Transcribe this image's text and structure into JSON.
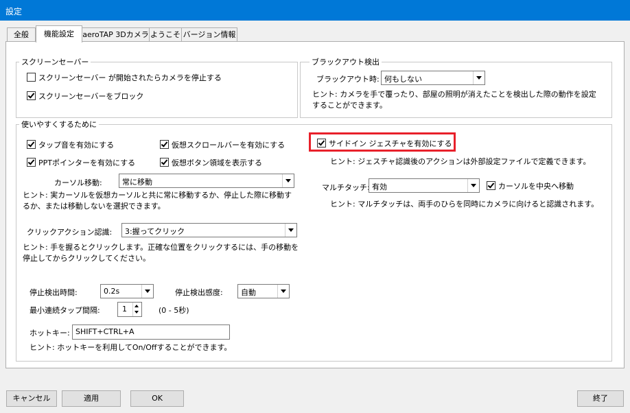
{
  "window": {
    "title": "設定"
  },
  "tabs": [
    {
      "label": "全般",
      "active": false
    },
    {
      "label": "機能設定",
      "active": true
    },
    {
      "label": "aeroTAP 3Dカメラ",
      "active": false
    },
    {
      "label": "ようこそ",
      "active": false
    },
    {
      "label": "バージョン情報",
      "active": false
    }
  ],
  "screensaver": {
    "title": "スクリーンセーバー",
    "stop_camera": {
      "label": "スクリーンセーバー が開始されたらカメラを停止する",
      "checked": false
    },
    "block": {
      "label": "スクリーンセーバーをブロック",
      "checked": true
    }
  },
  "blackout": {
    "title": "ブラックアウト検出",
    "label": "ブラックアウト時:",
    "value": "何もしない",
    "hint": "ヒント: カメラを手で覆ったり、部屋の照明が消えたことを検出した際の動作を設定することができます。"
  },
  "usability": {
    "title": "使いやすくするために",
    "tap_sound": {
      "label": "タップ音を有効にする",
      "checked": true
    },
    "virtual_scroll": {
      "label": "仮想スクロールバーを有効にする",
      "checked": true
    },
    "ppt_pointer": {
      "label": "PPTポインターを有効にする",
      "checked": true
    },
    "virtual_button": {
      "label": "仮想ボタン領域を表示する",
      "checked": true
    },
    "cursor_move_label": "カーソル移動:",
    "cursor_move_value": "常に移動",
    "cursor_hint": "ヒント: 実カーソルを仮想カーソルと共に常に移動するか、停止した際に移動するか、または移動しないを選択できます。",
    "click_action_label": "クリックアクション認識:",
    "click_action_value": "3:握ってクリック",
    "click_hint": "ヒント: 手を握るとクリックします。正確な位置をクリックするには、手の移動を停止してからクリックしてください。",
    "stop_detect_time_label": "停止検出時間:",
    "stop_detect_time_value": "0.2s",
    "stop_detect_sens_label": "停止検出感度:",
    "stop_detect_sens_value": "自動",
    "min_tap_label": "最小連続タップ間隔:",
    "min_tap_value": "1",
    "min_tap_range": "(0 - 5秒)",
    "hotkey_label": "ホットキー:",
    "hotkey_value": "SHIFT+CTRL+A",
    "hotkey_hint": "ヒント: ホットキーを利用してOn/Offすることができます。",
    "side_gesture": {
      "label": "サイドイン ジェスチャを有効にする",
      "checked": true
    },
    "gesture_hint": "ヒント: ジェスチャ認識後のアクションは外部設定ファイルで定義できます。",
    "multitouch_label": "マルチタッチ:",
    "multitouch_value": "有効",
    "center_cursor": {
      "label": "カーソルを中央へ移動",
      "checked": true
    },
    "multitouch_hint": "ヒント: マルチタッチは、両手のひらを同時にカメラに向けると認識されます。"
  },
  "buttons": {
    "cancel": "キャンセル",
    "apply": "適用",
    "ok": "OK",
    "exit": "終了"
  },
  "colors": {
    "titlebar": "#0078d7",
    "highlight": "#e8202a"
  }
}
